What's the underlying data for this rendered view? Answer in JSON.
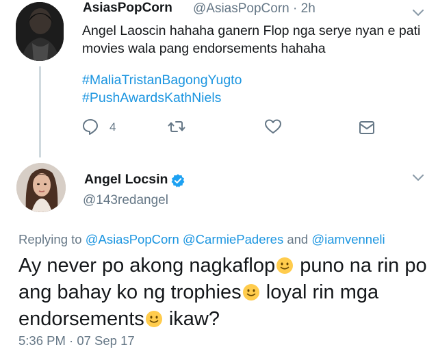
{
  "tweet1": {
    "display_name": "AsiasPopCorn",
    "handle_time": "@AsiasPopCorn · 2h",
    "text": "Angel Laoscin hahaha ganern Flop nga serye nyan e pati movies wala pang endorsements hahaha",
    "hashtags": [
      "#MaliaTristanBagongYugto",
      "#PushAwardsKathNiels"
    ],
    "reply_count": "4",
    "icons": {
      "reply": "reply-icon",
      "retweet": "retweet-icon",
      "like": "heart-icon",
      "dm": "envelope-icon",
      "menu": "chevron-down-icon"
    }
  },
  "tweet2": {
    "display_name": "Angel Locsin",
    "handle": "@143redangel",
    "replying_label": "Replying to",
    "reply_mention1": "@AsiasPopCorn",
    "reply_mention2": "@CarmiePaderes",
    "reply_and": "and",
    "reply_mention3": "@iamvenneli",
    "text_part1": "Ay never po akong nagkaflop",
    "text_part2": " puno na rin po ang bahay ko ng trophies",
    "text_part3": " loyal rin mga endorsements",
    "text_part4": " ikaw?",
    "timestamp": "5:36 PM · 07 Sep 17",
    "icons": {
      "verified": "verified-badge-icon",
      "emoji": "slightly-smiling-face-emoji",
      "menu": "chevron-down-icon"
    }
  },
  "colors": {
    "link": "#1b95e0",
    "secondary_text": "#657786",
    "primary_text": "#14171a",
    "thread_line": "#cfd9de"
  }
}
